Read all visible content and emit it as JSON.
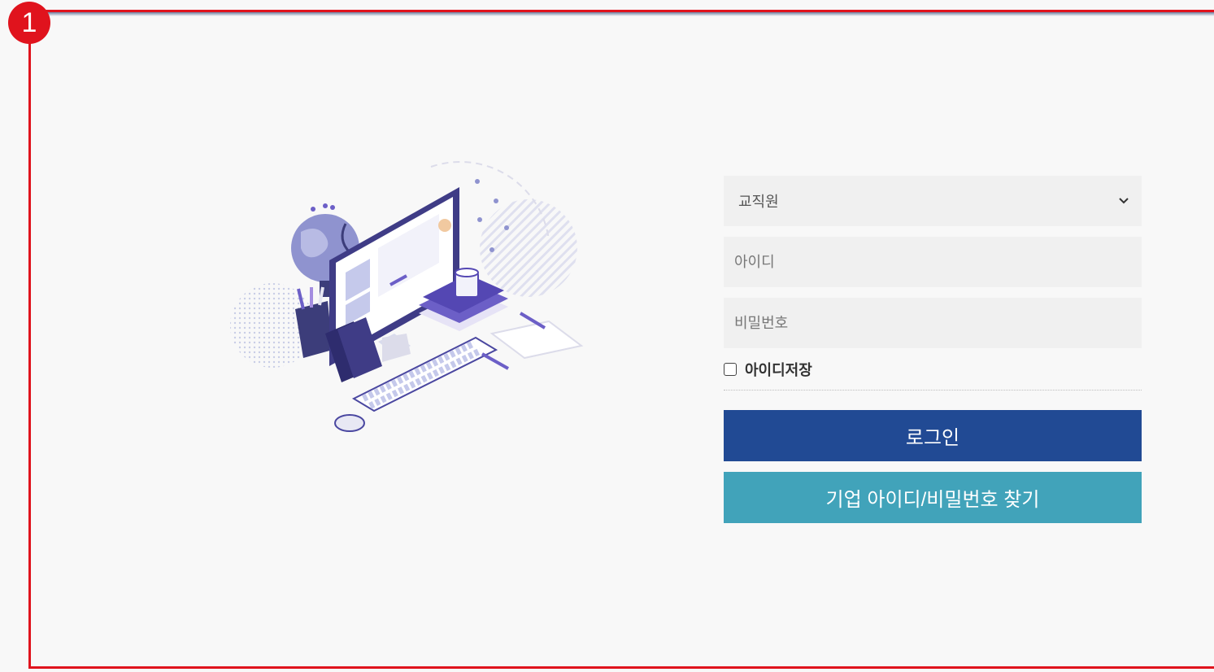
{
  "step_badge": "1",
  "login": {
    "user_type_selected": "교직원",
    "id_placeholder": "아이디",
    "password_placeholder": "비밀번호",
    "remember_label": "아이디저장",
    "login_button": "로그인",
    "find_button": "기업 아이디/비밀번호 찾기"
  },
  "colors": {
    "annotation_red": "#e0131d",
    "login_button": "#214a94",
    "find_button": "#41a3ba",
    "illustration_accent": "#6c5fc7"
  },
  "illustration": {
    "icon": "computer-workspace-illustration"
  }
}
